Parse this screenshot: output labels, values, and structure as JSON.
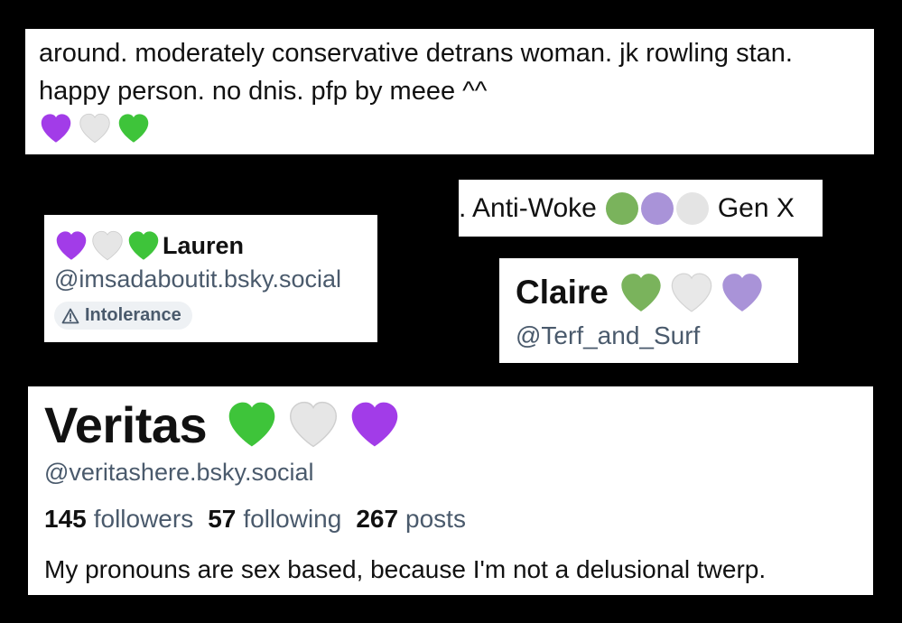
{
  "colors": {
    "purple_heart": "#a23ce8",
    "white_heart": "#e6e6e6",
    "green_heart": "#3ec43a",
    "green_dot": "#7ab35c",
    "purple_dot": "#a993d8",
    "white_dot": "#e4e4e4",
    "secondary_text": "#4a5a6c"
  },
  "bio_card": {
    "line1": "around. moderately conservative detrans woman. jk rowling stan.",
    "line2": "happy person. no dnis. pfp by meee ^^",
    "hearts": [
      "purple-heart-icon",
      "white-heart-icon",
      "green-heart-icon"
    ]
  },
  "antiwoke_card": {
    "prefix": ". Anti-Woke",
    "suffix": "Gen X",
    "dots": [
      "green-circle-icon",
      "purple-circle-icon",
      "white-circle-icon"
    ]
  },
  "lauren_card": {
    "name": "Lauren",
    "handle": "@imsadaboutit.bsky.social",
    "label": "Intolerance",
    "hearts": [
      "purple-heart-icon",
      "white-heart-icon",
      "green-heart-icon"
    ]
  },
  "claire_card": {
    "name": "Claire",
    "handle": "@Terf_and_Surf",
    "hearts": [
      "green-heart-icon",
      "white-heart-icon",
      "purple-heart-icon"
    ]
  },
  "veritas_card": {
    "name": "Veritas",
    "handle": "@veritashere.bsky.social",
    "followers_count": "145",
    "followers_label": "followers",
    "following_count": "57",
    "following_label": "following",
    "posts_count": "267",
    "posts_label": "posts",
    "description": "My pronouns are sex based, because I'm not a delusional twerp.",
    "hearts": [
      "green-heart-icon",
      "white-heart-icon",
      "purple-heart-icon"
    ]
  }
}
